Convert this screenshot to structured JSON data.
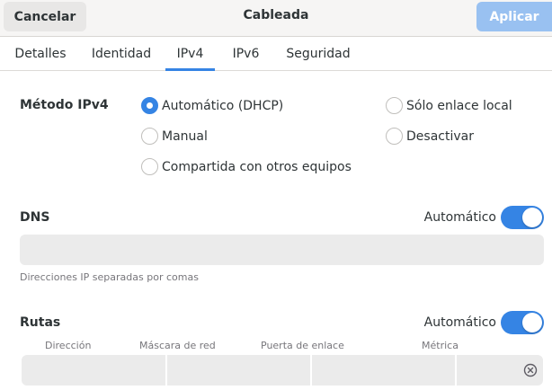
{
  "header": {
    "cancel_label": "Cancelar",
    "title": "Cableada",
    "apply_label": "Aplicar"
  },
  "tabs": [
    {
      "label": "Detalles",
      "active": false
    },
    {
      "label": "Identidad",
      "active": false
    },
    {
      "label": "IPv4",
      "active": true
    },
    {
      "label": "IPv6",
      "active": false
    },
    {
      "label": "Seguridad",
      "active": false
    }
  ],
  "method": {
    "label": "Método IPv4",
    "options": [
      {
        "label": "Automático (DHCP)",
        "selected": true
      },
      {
        "label": "Sólo enlace local",
        "selected": false
      },
      {
        "label": "Manual",
        "selected": false
      },
      {
        "label": "Desactivar",
        "selected": false
      },
      {
        "label": "Compartida con otros equipos",
        "selected": false
      }
    ]
  },
  "dns": {
    "label": "DNS",
    "auto_label": "Automático",
    "auto_on": true,
    "value": "",
    "hint": "Direcciones IP separadas por comas"
  },
  "routes": {
    "label": "Rutas",
    "auto_label": "Automático",
    "auto_on": true,
    "columns": [
      "Dirección",
      "Máscara de red",
      "Puerta de enlace",
      "Métrica"
    ],
    "remove_icon": "remove-circle-icon"
  },
  "colors": {
    "accent": "#3584e4",
    "apply_disabled": "#99c1f1",
    "entry_bg": "#ebebeb"
  }
}
